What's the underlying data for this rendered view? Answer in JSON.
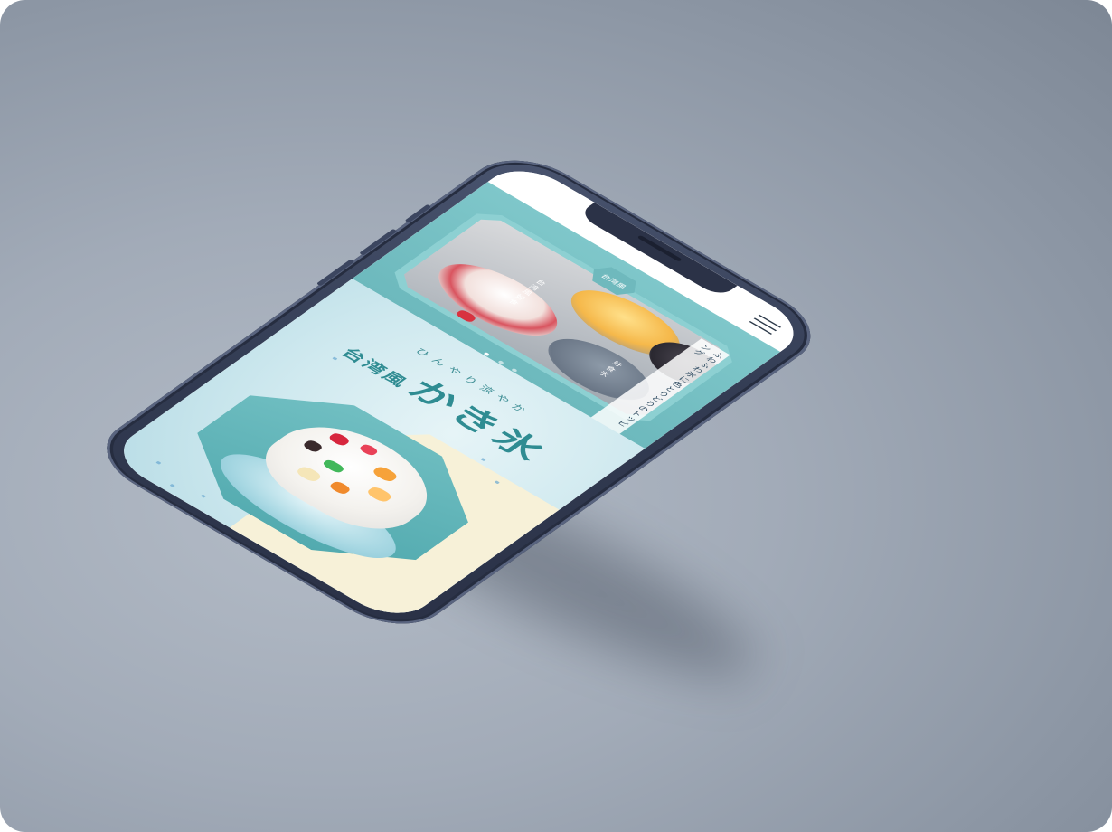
{
  "site": {
    "logo_text": "台湾風",
    "menu_icon": "hamburger-menu-icon"
  },
  "hero": {
    "tagline": "ふわふわ氷に色とりどりのトッピング",
    "caption_left": "台湾風好食",
    "caption_right": "好食氷",
    "slides_total": 3,
    "active_slide": 1
  },
  "feature": {
    "subtitle": "ひんやり涼やか",
    "title_prefix": "台湾風",
    "title_main": "かき氷"
  },
  "colors": {
    "teal": "#6fb9bd",
    "dark_teal": "#2f8c92",
    "cream": "#f7f1d8",
    "phone": "#323b52"
  }
}
